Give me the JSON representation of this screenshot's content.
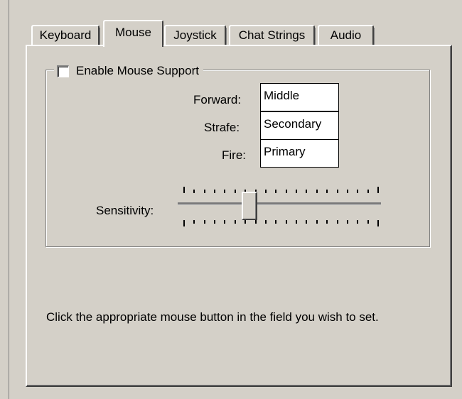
{
  "tabs": [
    {
      "label": "Keyboard",
      "active": false
    },
    {
      "label": "Mouse",
      "active": true
    },
    {
      "label": "Joystick",
      "active": false
    },
    {
      "label": "Chat Strings",
      "active": false
    },
    {
      "label": "Audio",
      "active": false
    }
  ],
  "mouse": {
    "enable_label": "Enable Mouse Support",
    "enable_checked": false,
    "forward_label": "Forward:",
    "forward_value": "Middle",
    "strafe_label": "Strafe:",
    "strafe_value": "Secondary",
    "fire_label": "Fire:",
    "fire_value": "Primary",
    "sensitivity_label": "Sensitivity:",
    "sensitivity_ticks": 20,
    "sensitivity_position": 0.34
  },
  "hint": "Click the appropriate mouse button in the field you wish to set.",
  "colors": {
    "face": "#d4d0c8",
    "shadow": "#808080",
    "highlight": "#ffffff"
  }
}
